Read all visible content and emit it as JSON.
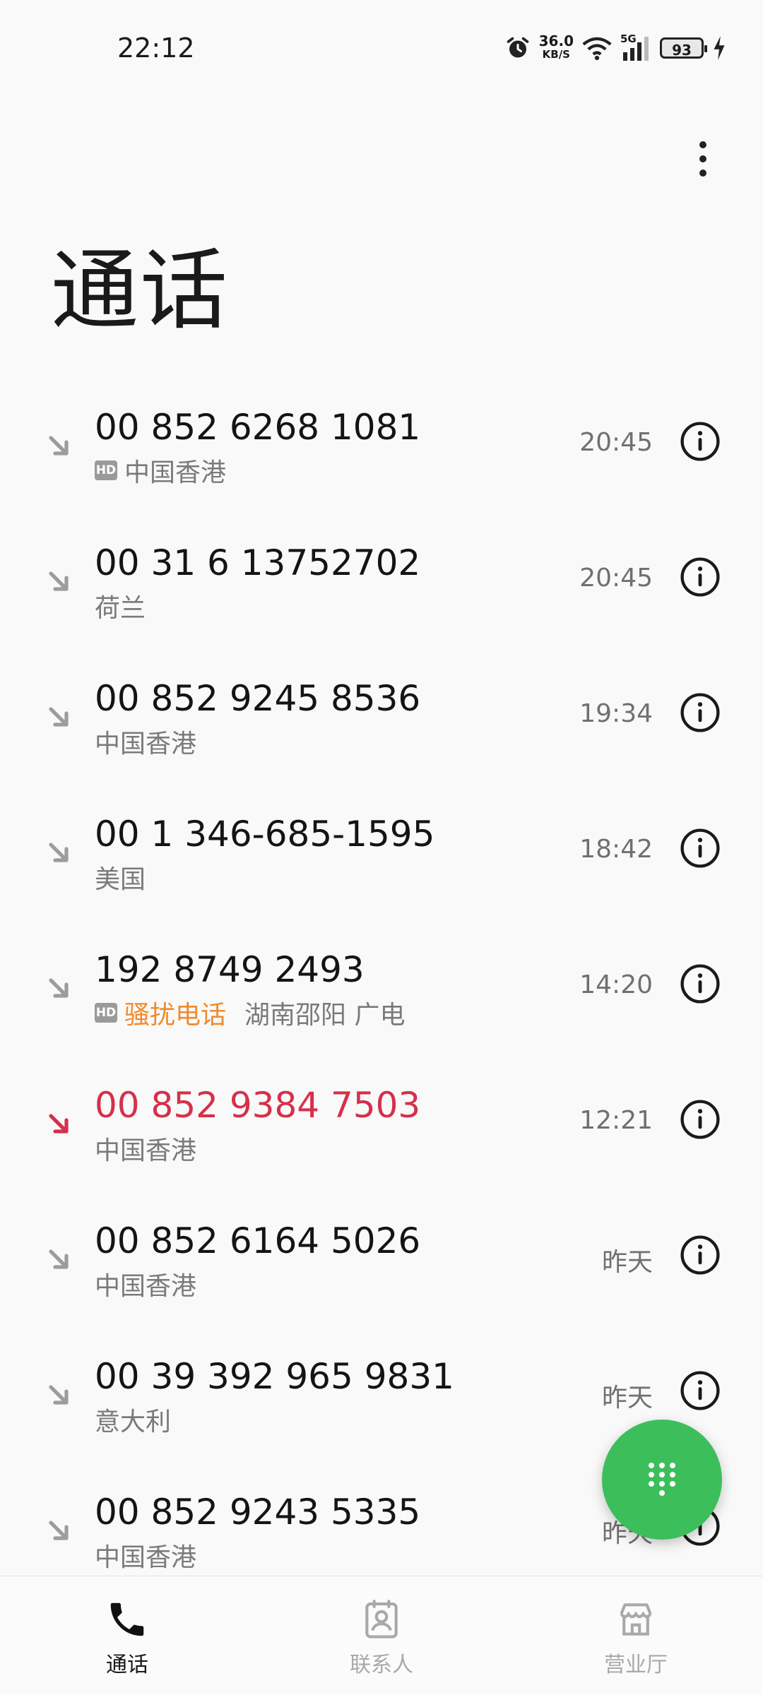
{
  "status_bar": {
    "time": "22:12",
    "net_speed_value": "36.0",
    "net_speed_unit": "KB/S",
    "network_type": "5G",
    "battery": "93"
  },
  "header": {
    "title": "通话"
  },
  "calls": [
    {
      "number": "00 852 6268 1081",
      "hd": true,
      "spam": "",
      "location": "中国香港",
      "time": "20:45",
      "missed": false
    },
    {
      "number": "00 31 6 13752702",
      "hd": false,
      "spam": "",
      "location": "荷兰",
      "time": "20:45",
      "missed": false
    },
    {
      "number": "00 852 9245 8536",
      "hd": false,
      "spam": "",
      "location": "中国香港",
      "time": "19:34",
      "missed": false
    },
    {
      "number": "00 1 346-685-1595",
      "hd": false,
      "spam": "",
      "location": "美国",
      "time": "18:42",
      "missed": false
    },
    {
      "number": "192 8749 2493",
      "hd": true,
      "spam": "骚扰电话",
      "location": "湖南邵阳 广电",
      "time": "14:20",
      "missed": false
    },
    {
      "number": "00 852 9384 7503",
      "hd": false,
      "spam": "",
      "location": "中国香港",
      "time": "12:21",
      "missed": true
    },
    {
      "number": "00 852 6164 5026",
      "hd": false,
      "spam": "",
      "location": "中国香港",
      "time": "昨天",
      "missed": false
    },
    {
      "number": "00 39 392 965 9831",
      "hd": false,
      "spam": "",
      "location": "意大利",
      "time": "昨天",
      "missed": false
    },
    {
      "number": "00 852 9243 5335",
      "hd": false,
      "spam": "",
      "location": "中国香港",
      "time": "昨天",
      "missed": false
    }
  ],
  "hd_badge_text": "HD",
  "bottom_nav": {
    "calls_label": "通话",
    "contacts_label": "联系人",
    "store_label": "营业厅"
  },
  "colors": {
    "missed": "#d6304a",
    "spam": "#f08a2c",
    "fab": "#3cbe5a"
  },
  "icons": {
    "incoming": "incoming-call-arrow-icon",
    "info": "info-icon",
    "dialpad": "dialpad-icon"
  }
}
